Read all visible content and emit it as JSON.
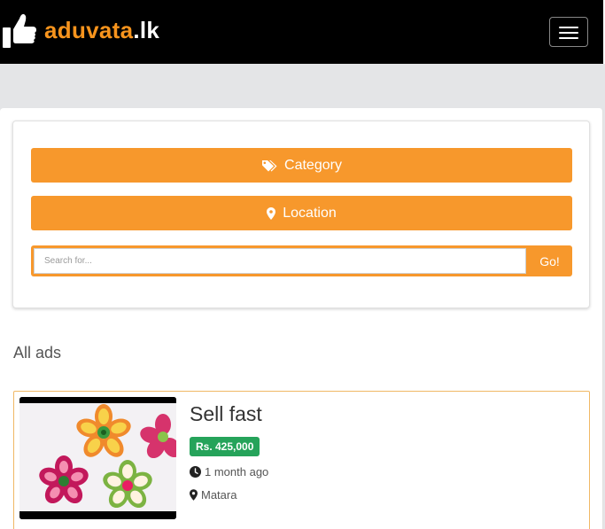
{
  "navbar": {
    "logo_brand": "aduvata",
    "logo_tld": ".lk"
  },
  "search": {
    "category_label": "Category",
    "location_label": "Location",
    "placeholder": "Search for...",
    "go_label": "Go!"
  },
  "section": {
    "title": "All ads"
  },
  "ads": [
    {
      "title": "Sell fast",
      "price": "Rs. 425,000",
      "time": "1 month ago",
      "location": "Matara"
    }
  ],
  "colors": {
    "accent": "#f7982c",
    "navbar": "#000000",
    "price_badge": "#25a35a"
  }
}
